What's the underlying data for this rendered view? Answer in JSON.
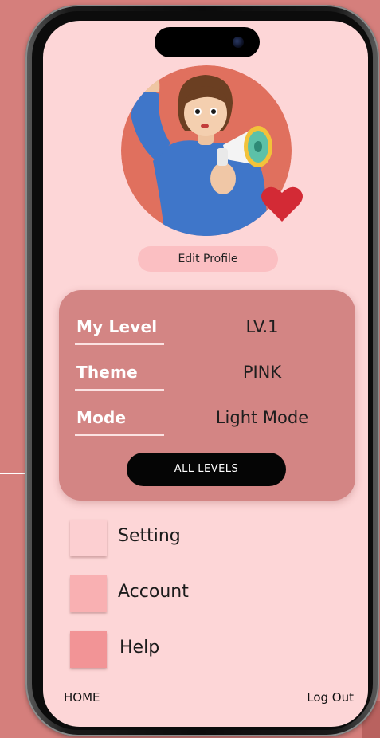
{
  "profile": {
    "edit_label": "Edit Profile"
  },
  "stats": {
    "rows": [
      {
        "label": "My Level",
        "value": "LV.1"
      },
      {
        "label": "Theme",
        "value": "PINK"
      },
      {
        "label": "Mode",
        "value": "Light Mode"
      }
    ],
    "all_levels_label": "ALL LEVELS"
  },
  "menu": [
    {
      "label": "Setting",
      "color": "#fccfd1"
    },
    {
      "label": "Account",
      "color": "#f9b0b2"
    },
    {
      "label": "Help",
      "color": "#f29496"
    }
  ],
  "footer": {
    "home_label": "HOME",
    "logout_label": "Log Out"
  },
  "colors": {
    "background": "#d57f7c",
    "screen": "#fdd6d7",
    "card": "#d38584",
    "accent_dark": "#050505"
  }
}
